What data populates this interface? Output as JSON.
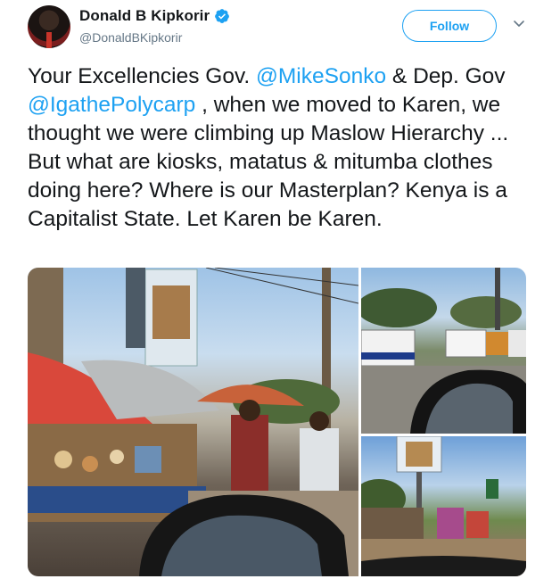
{
  "user": {
    "display_name": "Donald B Kipkorir",
    "handle": "@DonaldBKipkorir",
    "verified_icon": "verified-badge-icon",
    "avatar_icon": "profile-photo"
  },
  "actions": {
    "follow_label": "Follow",
    "more_icon": "chevron-down-icon"
  },
  "tweet": {
    "text_1": "Your Excellencies Gov. ",
    "mention_1": "@MikeSonko",
    "text_2": " & Dep. Gov ",
    "mention_2": "@IgathePolycarp",
    "text_3": " , when we moved to Karen, we thought we were climbing up Maslow Hierarchy ... But what are kiosks, matatus & mitumba clothes doing here? Where is our Masterplan? Kenya is a Capitalist State. Let Karen be Karen."
  },
  "media": {
    "photos": [
      {
        "name": "street-market-photo"
      },
      {
        "name": "vehicles-parked-photo"
      },
      {
        "name": "roadside-stalls-photo"
      }
    ]
  },
  "colors": {
    "accent": "#1da1f2",
    "text": "#14171a",
    "secondary_text": "#657786"
  }
}
